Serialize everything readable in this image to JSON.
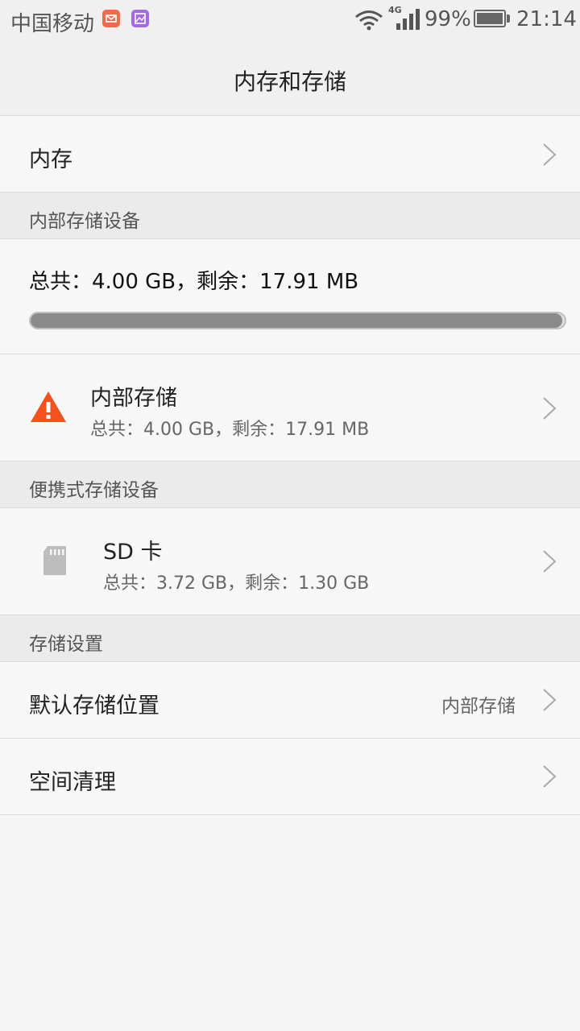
{
  "status_bar": {
    "carrier": "中国移动",
    "network": "4G",
    "battery_percent": "99%",
    "battery_level": 0.99,
    "time": "21:14",
    "notifications": [
      "mail-icon",
      "gallery-icon"
    ]
  },
  "header": {
    "title": "内存和存储"
  },
  "memory_row": {
    "label": "内存"
  },
  "internal_section": {
    "label": "内部存储设备",
    "summary": "总共：4.00 GB，剩余：17.91 MB",
    "usage_fraction": 0.996,
    "item": {
      "title": "内部存储",
      "subtitle": "总共：4.00 GB，剩余：17.91 MB",
      "icon": "warning-icon",
      "icon_color": "#f4511e"
    }
  },
  "portable_section": {
    "label": "便携式存储设备",
    "item": {
      "title": "SD 卡",
      "subtitle": "总共：3.72 GB，剩余：1.30 GB",
      "icon": "sd-card-icon"
    }
  },
  "settings_section": {
    "label": "存储设置",
    "default_location": {
      "label": "默认存储位置",
      "value": "内部存储"
    },
    "cleanup": {
      "label": "空间清理"
    }
  }
}
